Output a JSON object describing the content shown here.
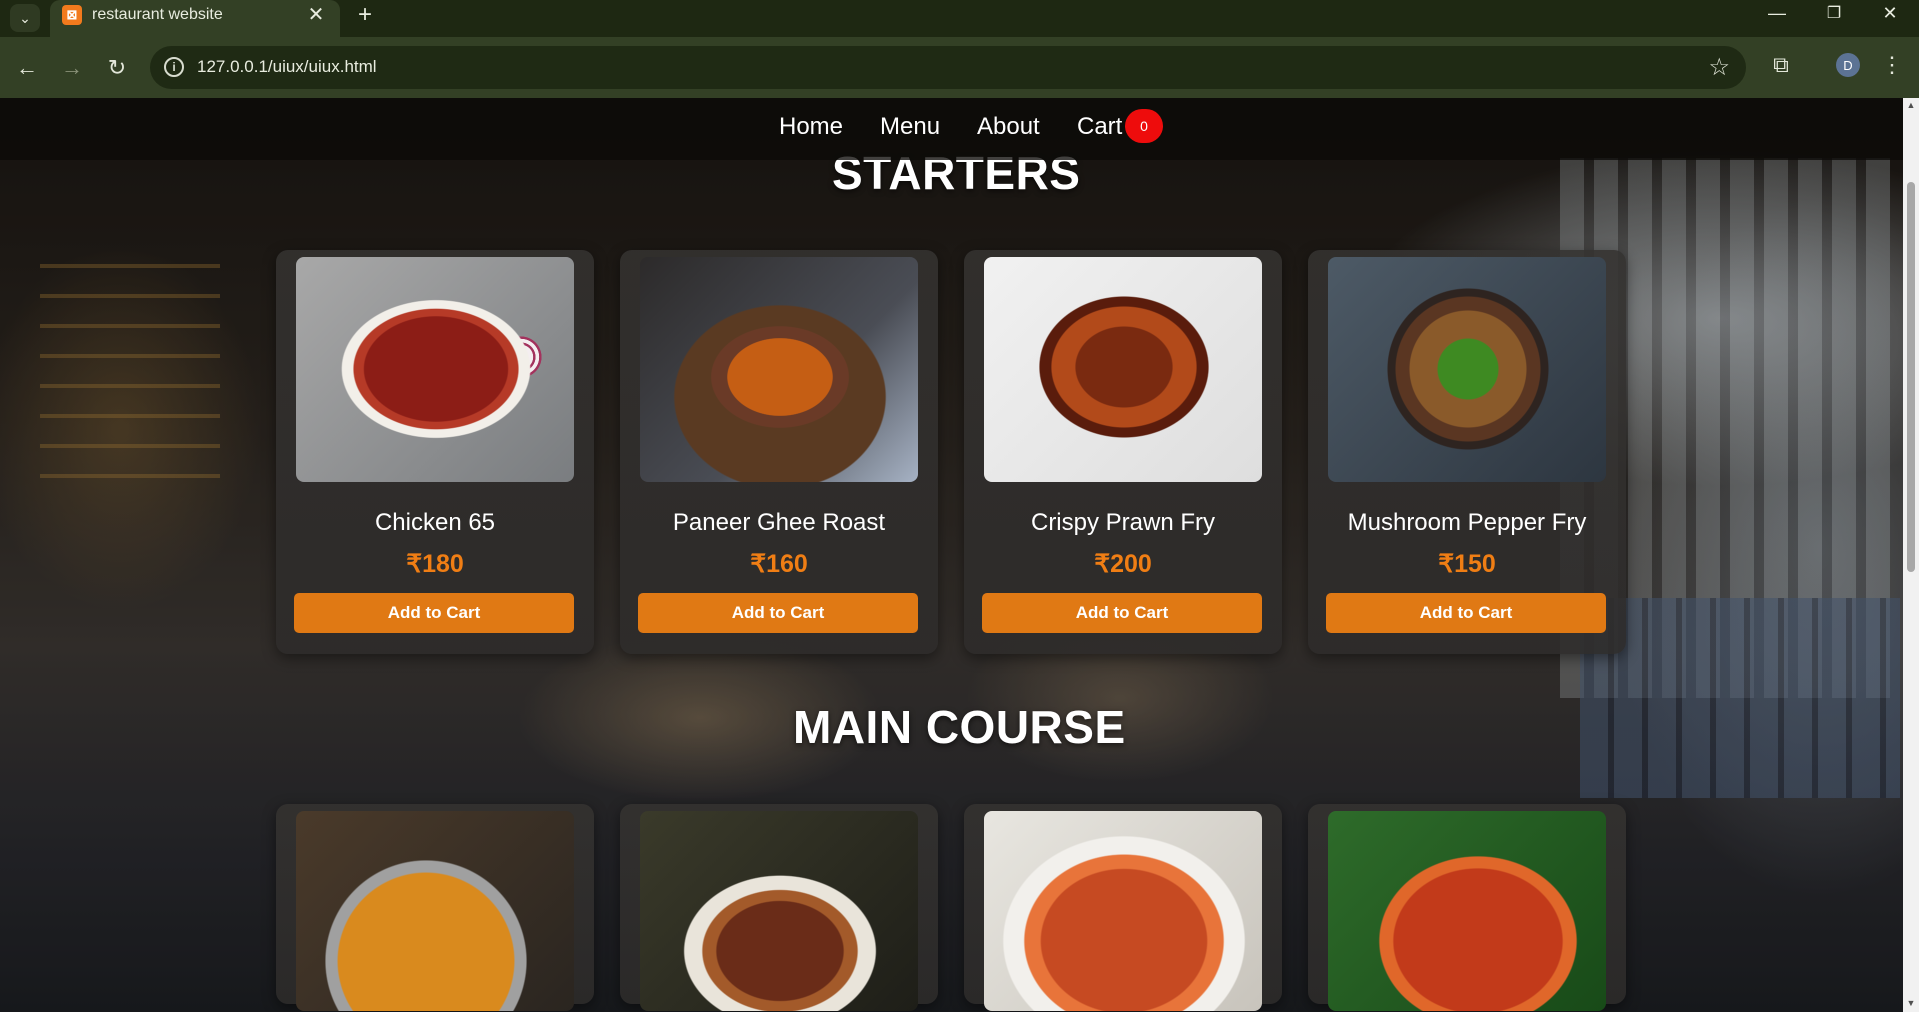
{
  "browser": {
    "tab_title": "restaurant website",
    "url": "127.0.0.1/uiux/uiux.html",
    "profile_initial": "D",
    "icons": {
      "tab_list": "chevron-down-icon",
      "favicon": "xampp-icon",
      "tab_close": "close-icon",
      "new_tab": "plus-icon",
      "back": "arrow-left-icon",
      "forward": "arrow-right-icon",
      "reload": "reload-icon",
      "site_info": "info-icon",
      "bookmark": "star-icon",
      "extensions": "puzzle-icon",
      "menu": "kebab-icon",
      "minimize": "minimize-icon",
      "maximize": "restore-icon",
      "close": "close-icon"
    },
    "glyphs": {
      "tab_list": "⌄",
      "favicon": "⊠",
      "tab_close": "✕",
      "new_tab": "+",
      "back": "←",
      "forward": "→",
      "reload": "↻",
      "site_info": "i",
      "bookmark": "☆",
      "extensions": "⧉",
      "menu": "⋮",
      "minimize": "—",
      "maximize": "❐",
      "close": "✕",
      "scroll_up": "▲",
      "scroll_down": "▼"
    }
  },
  "nav": {
    "links": [
      "Home",
      "Menu",
      "About",
      "Cart"
    ],
    "cart_count": "0"
  },
  "sections": {
    "starters": {
      "title": "STARTERS",
      "items": [
        {
          "name": "Chicken 65",
          "price": "₹180",
          "button": "Add to Cart"
        },
        {
          "name": "Paneer Ghee Roast",
          "price": "₹160",
          "button": "Add to Cart"
        },
        {
          "name": "Crispy Prawn Fry",
          "price": "₹200",
          "button": "Add to Cart"
        },
        {
          "name": "Mushroom Pepper Fry",
          "price": "₹150",
          "button": "Add to Cart"
        }
      ]
    },
    "main_course": {
      "title": "MAIN COURSE"
    }
  },
  "colors": {
    "accent": "#e07914",
    "price": "#f07e14",
    "badge": "#ee0c0c"
  }
}
